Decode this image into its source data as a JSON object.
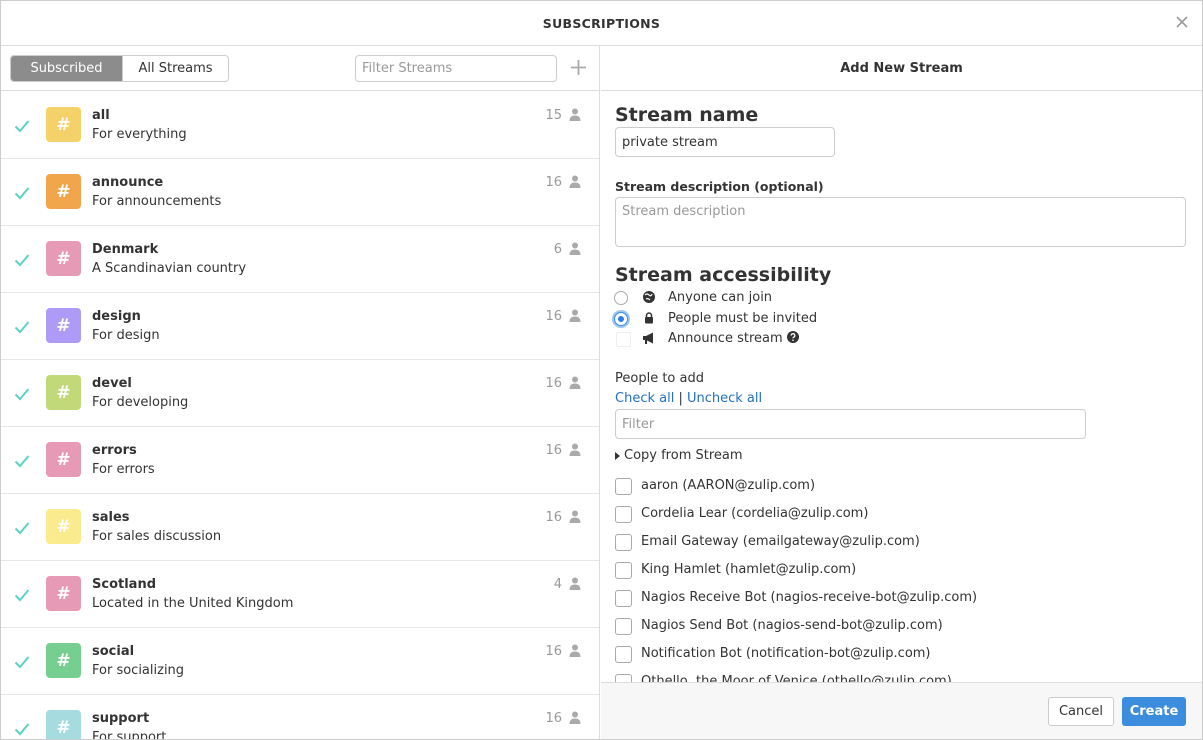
{
  "header": {
    "title": "SUBSCRIPTIONS"
  },
  "left": {
    "tabs": {
      "subscribed": "Subscribed",
      "all": "All Streams"
    },
    "filter_placeholder": "Filter Streams"
  },
  "streams": [
    {
      "name": "all",
      "description": "For everything",
      "count": "15",
      "color": "#f5d169"
    },
    {
      "name": "announce",
      "description": "For announcements",
      "count": "16",
      "color": "#f2a64c"
    },
    {
      "name": "Denmark",
      "description": "A Scandinavian country",
      "count": "6",
      "color": "#e79ab6"
    },
    {
      "name": "design",
      "description": "For design",
      "count": "16",
      "color": "#ad9bf5"
    },
    {
      "name": "devel",
      "description": "For developing",
      "count": "16",
      "color": "#c2d97a"
    },
    {
      "name": "errors",
      "description": "For errors",
      "count": "16",
      "color": "#e79ab6"
    },
    {
      "name": "sales",
      "description": "For sales discussion",
      "count": "16",
      "color": "#faeb8e"
    },
    {
      "name": "Scotland",
      "description": "Located in the United Kingdom",
      "count": "4",
      "color": "#e79ab6"
    },
    {
      "name": "social",
      "description": "For socializing",
      "count": "16",
      "color": "#76ce90"
    },
    {
      "name": "support",
      "description": "For support",
      "count": "16",
      "color": "#a6dcdf"
    }
  ],
  "right": {
    "title": "Add New Stream",
    "stream_name_heading": "Stream name",
    "stream_name_value": "private stream",
    "description_heading": "Stream description (optional)",
    "description_placeholder": "Stream description",
    "accessibility_heading": "Stream accessibility",
    "options": {
      "anyone": "Anyone can join",
      "invited": "People must be invited",
      "announce": "Announce stream"
    },
    "people_to_add": "People to add",
    "check_all": "Check all",
    "separator": "|",
    "uncheck_all": "Uncheck all",
    "people_filter_placeholder": "Filter",
    "copy_from_stream": "Copy from Stream",
    "people": [
      "aaron (AARON@zulip.com)",
      "Cordelia Lear (cordelia@zulip.com)",
      "Email Gateway (emailgateway@zulip.com)",
      "King Hamlet (hamlet@zulip.com)",
      "Nagios Receive Bot (nagios-receive-bot@zulip.com)",
      "Nagios Send Bot (nagios-send-bot@zulip.com)",
      "Notification Bot (notification-bot@zulip.com)",
      "Othello, the Moor of Venice (othello@zulip.com)"
    ],
    "cancel_label": "Cancel",
    "create_label": "Create"
  },
  "colors": {
    "check": "#5ad3c4",
    "accent": "#3c8dde",
    "link": "#2470c2"
  }
}
